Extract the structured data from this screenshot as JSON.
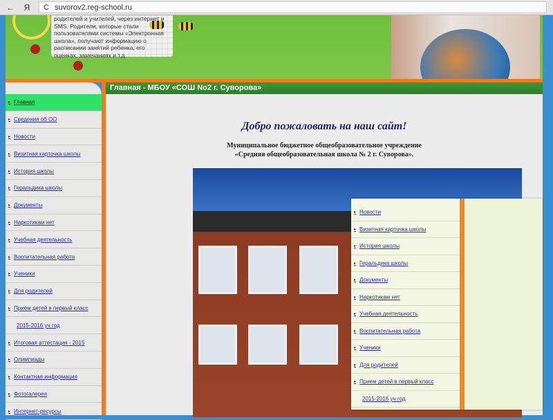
{
  "browser": {
    "back": "←",
    "yandex": "Я",
    "refresh": "C",
    "url": "suvorov2.reg-school.ru"
  },
  "header": {
    "note": "родителей и учителей, через интернет и SMS. Родители, которые стали пользователями системы «Электронная школа», получают информацию о расписании занятий ребенка, его оценках, замечаниях и т.д."
  },
  "page_title": "Главная - МБОУ «СОШ No2 г. Суворова»",
  "welcome": "Добро пожаловать на наш сайт!",
  "org_line1": "Муниципальное бюджетное общеобразовательное учреждение",
  "org_line2": "«Средняя общеобразовательная школа № 2 г. Суворова».",
  "sidebar": [
    "Главная",
    "Сведения об ОО",
    "Новости",
    "Визитная карточка школы",
    "История школы",
    "Геральдика школы",
    "Документы",
    "Наркотикам нет",
    "Учебная деятельность",
    "Воспитательная работа",
    "Ученики",
    "Для родителей",
    "Прием детей в первый класс",
    "2015-2016 уч год",
    "Итоговая аттестация - 2015",
    "Олимпиады",
    "Контактная информация",
    "Фотогалерея",
    "Интернет-ресурсы"
  ],
  "overlay": [
    "Новости",
    "Визитная карточка школы",
    "История школы",
    "Геральдика школы",
    "Документы",
    "Наркотикам нет",
    "Учебная деятельность",
    "Воспитательная работа",
    "Ученики",
    "Для родителей",
    "Прием детей в первый класс",
    "2015-2016 уч год"
  ],
  "bullet": "▸"
}
